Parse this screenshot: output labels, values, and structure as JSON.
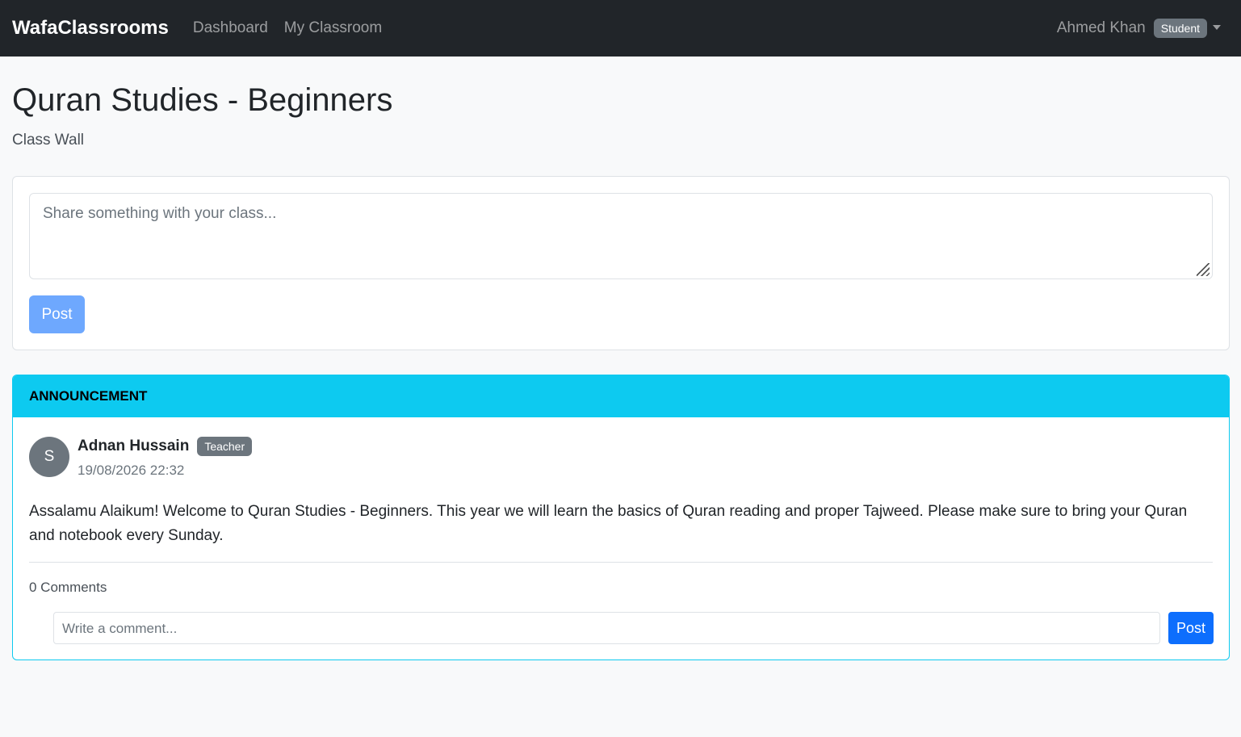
{
  "navbar": {
    "brand": "WafaClassrooms",
    "links": [
      "Dashboard",
      "My Classroom"
    ],
    "user": {
      "name": "Ahmed Khan",
      "role": "Student"
    }
  },
  "page": {
    "title": "Quran Studies - Beginners",
    "subtitle": "Class Wall"
  },
  "composer": {
    "placeholder": "Share something with your class...",
    "post_label": "Post"
  },
  "posts": [
    {
      "type_label": "ANNOUNCEMENT",
      "avatar_initial": "S",
      "author": "Adnan Hussain",
      "author_role": "Teacher",
      "timestamp": "19/08/2026 22:32",
      "body": "Assalamu Alaikum! Welcome to Quran Studies - Beginners. This year we will learn the basics of Quran reading and proper Tajweed. Please make sure to bring your Quran and notebook every Sunday.",
      "comments_label": "0 Comments",
      "comment_placeholder": "Write a comment...",
      "comment_post_label": "Post"
    }
  ],
  "colors": {
    "navbar_bg": "#212529",
    "announcement_header": "#0dcaf0",
    "primary": "#0d6efd",
    "primary_disabled": "#6ea8fe",
    "badge_bg": "#6c757d"
  }
}
